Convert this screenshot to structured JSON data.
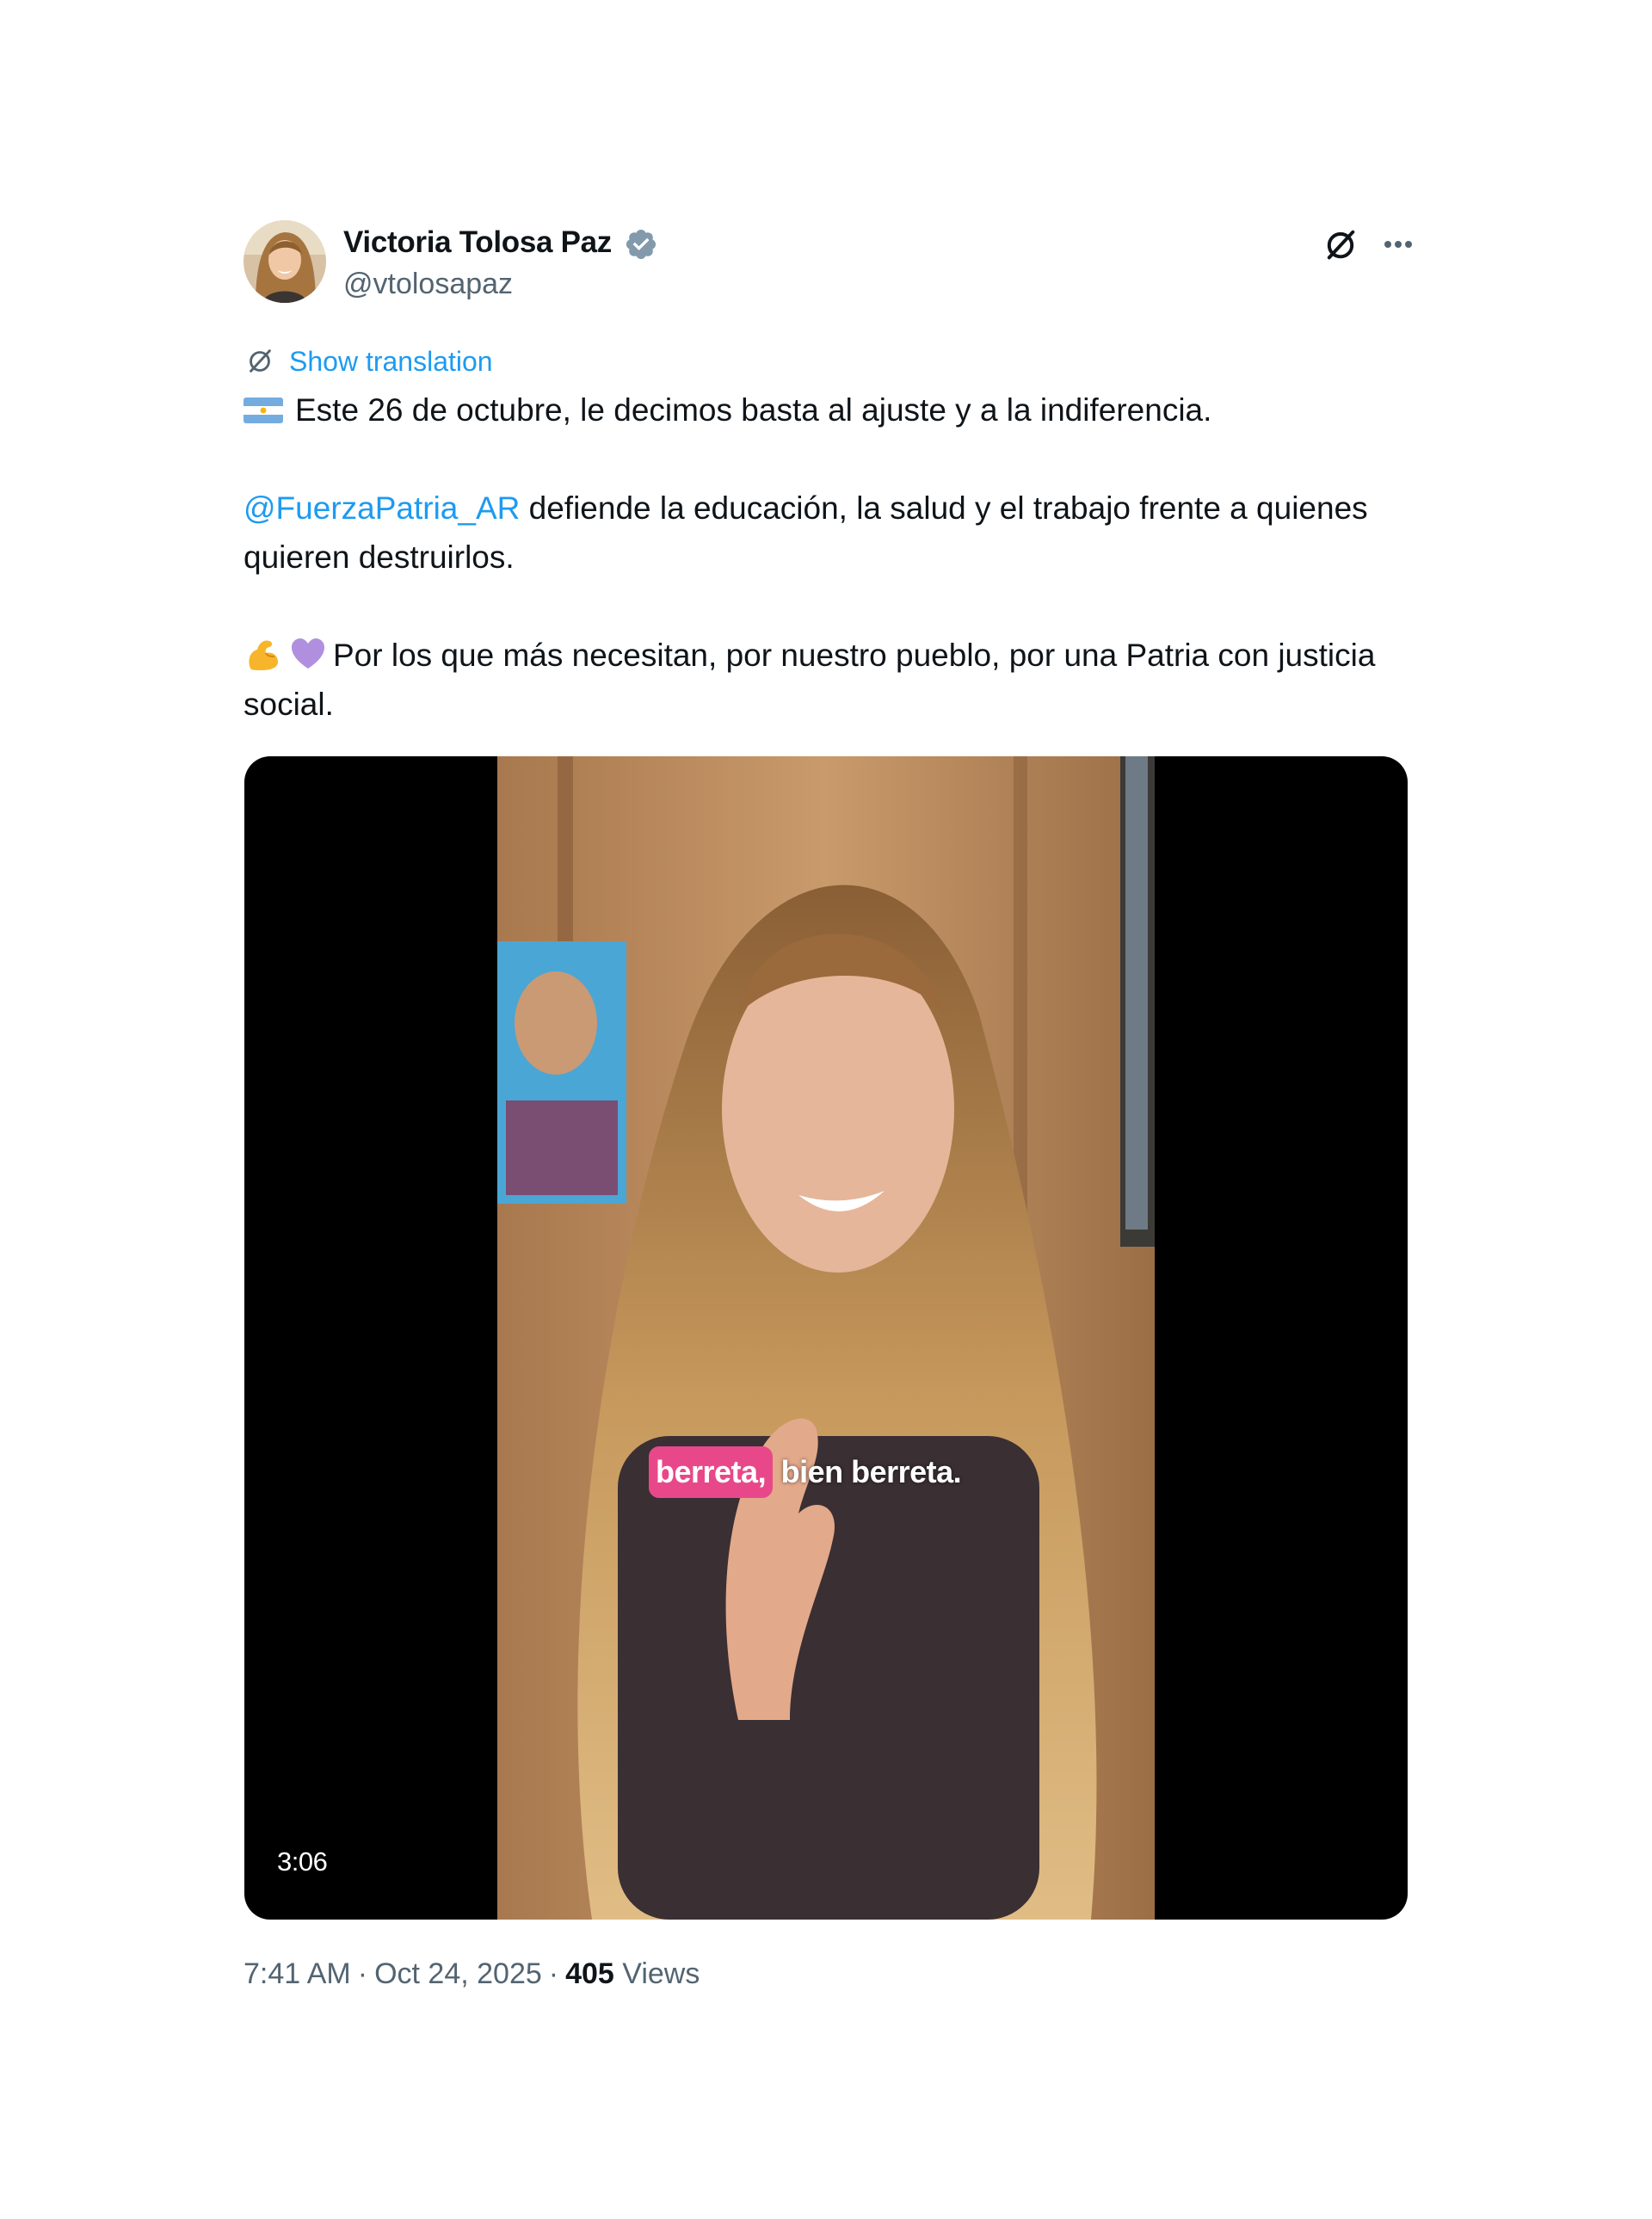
{
  "author": {
    "display_name": "Victoria Tolosa Paz",
    "handle": "@vtolosapaz",
    "verified": true,
    "verified_color": "#829aab"
  },
  "actions": {
    "grok_icon": "grok-icon",
    "more_icon": "more-dots-icon"
  },
  "translation": {
    "label": "Show translation"
  },
  "tweet": {
    "line1": "Este 26 de octubre, le decimos basta al ajuste y a la indiferencia.",
    "mention": "@FuerzaPatria_AR",
    "line2": " defiende la educación, la salud y el trabajo frente a quienes quieren destruirlos.",
    "line3": "Por los que más necesitan, por nuestro pueblo, por una Patria con justicia social.",
    "emojis": [
      "argentina-flag",
      "flexed-biceps",
      "purple-heart"
    ]
  },
  "media": {
    "type": "video",
    "caption_highlight": "berreta,",
    "caption_rest": " bien berreta.",
    "duration": "3:06",
    "caption_color": "#e8488a"
  },
  "meta": {
    "time": "7:41 AM",
    "date": "Oct 24, 2025",
    "separator": "·",
    "views_count": "405",
    "views_label": "Views"
  },
  "colors": {
    "link": "#1d9bf0",
    "secondary_text": "#536471",
    "primary_text": "#0f1419"
  }
}
